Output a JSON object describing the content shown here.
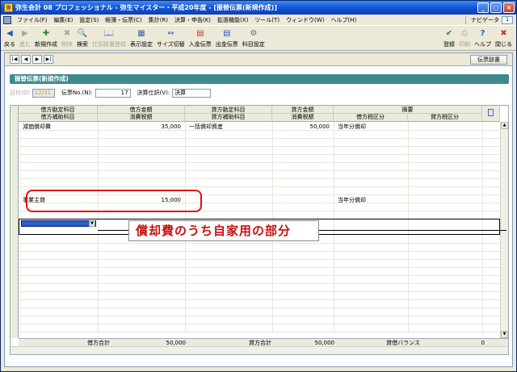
{
  "window": {
    "icon_label": "弥",
    "title": "弥生会計 08 プロフェッショナル - 弥生マイスター・平成20年度 - [振替伝票(新規作成)]",
    "buttons": {
      "minimize": "_",
      "maximize": "□",
      "close": "×"
    }
  },
  "menubar": {
    "items": [
      "ファイル(F)",
      "編集(E)",
      "設定(S)",
      "帳簿・伝票(C)",
      "集計(R)",
      "決算・申告(K)",
      "拡張機能(X)",
      "ツール(T)",
      "ウィンドウ(W)",
      "ヘルプ(H)"
    ],
    "navi_label": "ナビゲータ",
    "navi_value": "1"
  },
  "toolbar": {
    "left": [
      {
        "label": "戻る",
        "icon": "◀",
        "disabled": false
      },
      {
        "label": "進む",
        "icon": "▶",
        "disabled": true
      },
      {
        "label": "新規作成",
        "icon": "✚",
        "disabled": false
      },
      {
        "label": "削除",
        "icon": "✖",
        "disabled": true
      },
      {
        "label": "検索",
        "icon": "🔍",
        "disabled": false
      },
      {
        "label": "仕訳辞書登録",
        "icon": "📖",
        "disabled": true
      },
      {
        "label": "表示設定",
        "icon": "▦",
        "disabled": false
      },
      {
        "label": "サイズ切替",
        "icon": "⇔",
        "disabled": false
      },
      {
        "label": "入金伝票",
        "icon": "▤",
        "disabled": false
      },
      {
        "label": "出金伝票",
        "icon": "▤",
        "disabled": false
      },
      {
        "label": "科目設定",
        "icon": "⚙",
        "disabled": false
      }
    ],
    "right": [
      {
        "label": "登録",
        "icon": "✔",
        "disabled": false
      },
      {
        "label": "印刷",
        "icon": "⎙",
        "disabled": true
      },
      {
        "label": "ヘルプ",
        "icon": "?",
        "disabled": false
      },
      {
        "label": "閉じる",
        "icon": "✖",
        "disabled": false
      }
    ]
  },
  "navbar": {
    "buttons": [
      "|◀",
      "◀",
      "▶",
      "▶|"
    ],
    "dict_button": "伝票辞書"
  },
  "document": {
    "title": "振替伝票(新規作成)",
    "date_label": "日付(D)",
    "date_value": "12/31",
    "slip_no_label": "伝票No.(N):",
    "slip_no_value": "17",
    "closing_label": "決算仕訳(V):",
    "closing_value": "決算"
  },
  "grid": {
    "headers": {
      "debit_account": "借方勘定科目",
      "debit_sub": "借方補助科目",
      "debit_amount": "借方金額",
      "debit_tax": "消費税額",
      "credit_account": "貸方勘定科目",
      "credit_sub": "貸方補助科目",
      "credit_amount": "貸方金額",
      "credit_tax": "消費税額",
      "memo": "摘要",
      "debit_tax_class": "借方税区分",
      "credit_tax_class": "貸方税区分"
    },
    "rows": [
      {
        "debit_account": "減価償却費",
        "debit_amount": "35,000",
        "credit_account": "一括償却資産",
        "credit_amount": "50,000",
        "memo": "当年分償却"
      },
      {
        "debit_account": "事業主貸",
        "debit_amount": "15,000",
        "credit_account": "",
        "credit_amount": "",
        "memo": "当年分償却"
      }
    ],
    "footer": {
      "debit_total_label": "借方合計",
      "debit_total": "50,000",
      "credit_total_label": "貸方合計",
      "credit_total": "50,000",
      "balance_label": "貸借バランス",
      "balance": "0"
    }
  },
  "annotation": {
    "callout": "償却費のうち自家用の部分",
    "colors": {
      "highlight": "#e01010",
      "text": "#c81010"
    }
  }
}
